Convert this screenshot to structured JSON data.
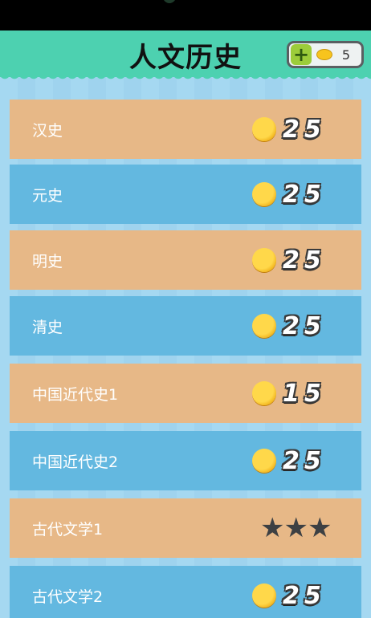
{
  "header": {
    "title": "人文历史",
    "coin_count": "5"
  },
  "rows": [
    {
      "label": "汉史",
      "price": "25"
    },
    {
      "label": "元史",
      "price": "25"
    },
    {
      "label": "明史",
      "price": "25"
    },
    {
      "label": "清史",
      "price": "25"
    },
    {
      "label": "中国近代史1",
      "price": "15"
    },
    {
      "label": "中国近代史2",
      "price": "25"
    },
    {
      "label": "古代文学1",
      "stars": 3
    },
    {
      "label": "古代文学2",
      "price": "25"
    }
  ],
  "colors": {
    "header": "#4dd1b0",
    "row_tan": "#e7b887",
    "row_blue": "#63b8e0",
    "background": "#a5d8f1",
    "coin": "#f7c41d"
  },
  "icons": [
    "plus-icon",
    "coin-icon",
    "star-icon"
  ]
}
